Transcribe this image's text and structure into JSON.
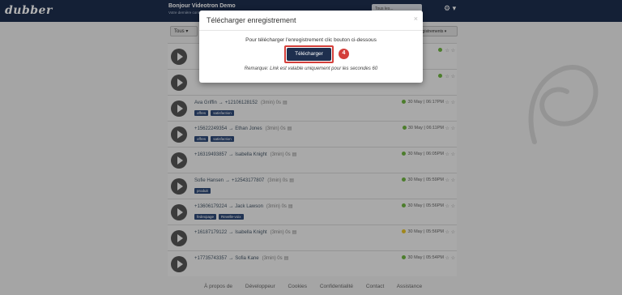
{
  "header": {
    "logo": "dubber",
    "title": "Bonjour Videotron Demo",
    "subtitle": "Votre dernière connexion",
    "search_placeholder": "Tous les...",
    "gear_icon": "gear-icon"
  },
  "toolbar": {
    "filter_label": "Tous",
    "right_filter_label": "Enregistrements"
  },
  "recordings": [
    {
      "from": "",
      "to": "",
      "duration": "",
      "tags": [],
      "date": "",
      "status": "green"
    },
    {
      "from": "",
      "to": "",
      "duration": "",
      "tags": [],
      "date": "",
      "status": "green"
    },
    {
      "from": "Ava Griffin",
      "to": "+12106128152",
      "duration": "(3min) 0s",
      "tags": [
        "offres",
        "satisfaction"
      ],
      "date": "30 May | 06:17PM",
      "status": "green"
    },
    {
      "from": "+15622249354",
      "to": "Ethan Jones",
      "duration": "(3min) 0s",
      "tags": [
        "offres",
        "satisfaction"
      ],
      "date": "30 May | 06:11PM",
      "status": "green"
    },
    {
      "from": "+16319493857",
      "to": "Isabella Knight",
      "duration": "(3min) 0s",
      "tags": [],
      "date": "30 May | 06:05PM",
      "status": "green"
    },
    {
      "from": "Sofie Hansen",
      "to": "+12543177807",
      "duration": "(3min) 0s",
      "tags": [
        "produit"
      ],
      "date": "30 May | 05:59PM",
      "status": "green"
    },
    {
      "from": "+13606179224",
      "to": "Jack Lawson",
      "duration": "(3min) 0s",
      "tags": [
        "fedexpage",
        "Revelle-voix"
      ],
      "date": "30 May | 05:56PM",
      "status": "green"
    },
    {
      "from": "+16187179122",
      "to": "Isabella Knight",
      "duration": "(3min) 0s",
      "tags": [],
      "date": "30 May | 05:56PM",
      "status": "yellow"
    },
    {
      "from": "+17735743357",
      "to": "Sofia Kane",
      "duration": "(3min) 0s",
      "tags": [],
      "date": "30 May | 05:54PM",
      "status": "green"
    }
  ],
  "footer": {
    "links": [
      "À propos de",
      "Développeur",
      "Cookies",
      "Confidentialité",
      "Contact",
      "Assistance"
    ]
  },
  "modal": {
    "title": "Télécharger enregistrement",
    "close": "×",
    "message": "Pour télécharger l'enregistrement clic bouton ci-dessous",
    "download_label": "Télécharger",
    "step": "4",
    "note": "Remarque: Link est valable uniquement pour les secondes 60"
  },
  "colors": {
    "navy": "#1e2f4e",
    "highlight_red": "#d43f3a",
    "status_green": "#6db33f",
    "status_yellow": "#e6c229"
  }
}
